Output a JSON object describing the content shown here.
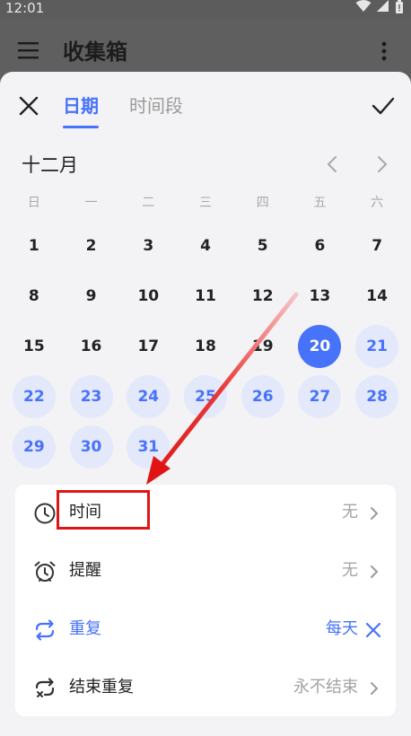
{
  "status_bar": {
    "time": "12:01"
  },
  "app_bar": {
    "title": "收集箱"
  },
  "tabs": [
    {
      "label": "日期",
      "active": true
    },
    {
      "label": "时间段",
      "active": false
    }
  ],
  "calendar": {
    "month": "十二月",
    "weekdays": [
      "日",
      "一",
      "二",
      "三",
      "四",
      "五",
      "六"
    ],
    "days": [
      "1",
      "2",
      "3",
      "4",
      "5",
      "6",
      "7",
      "8",
      "9",
      "10",
      "11",
      "12",
      "13",
      "14",
      "15",
      "16",
      "17",
      "18",
      "19",
      "20",
      "21",
      "22",
      "23",
      "24",
      "25",
      "26",
      "27",
      "28",
      "29",
      "30",
      "31"
    ],
    "selected_day": "20",
    "repeat_highlight_from": "21"
  },
  "options": {
    "time": {
      "label": "时间",
      "value": "无"
    },
    "reminder": {
      "label": "提醒",
      "value": "无"
    },
    "repeat": {
      "label": "重复",
      "value": "每天"
    },
    "end_repeat": {
      "label": "结束重复",
      "value": "永不结束"
    }
  },
  "colors": {
    "accent": "#4772fa",
    "accent_light": "#e3e8fb",
    "annotation": "#e01414",
    "overlay": "#5f5f5f",
    "sheet": "#f3f3f5"
  },
  "icons": {
    "close": "close-icon",
    "confirm": "check-icon",
    "time": "clock-icon",
    "reminder": "alarm-clock-icon",
    "repeat": "repeat-icon",
    "end_repeat": "end-repeat-icon"
  }
}
